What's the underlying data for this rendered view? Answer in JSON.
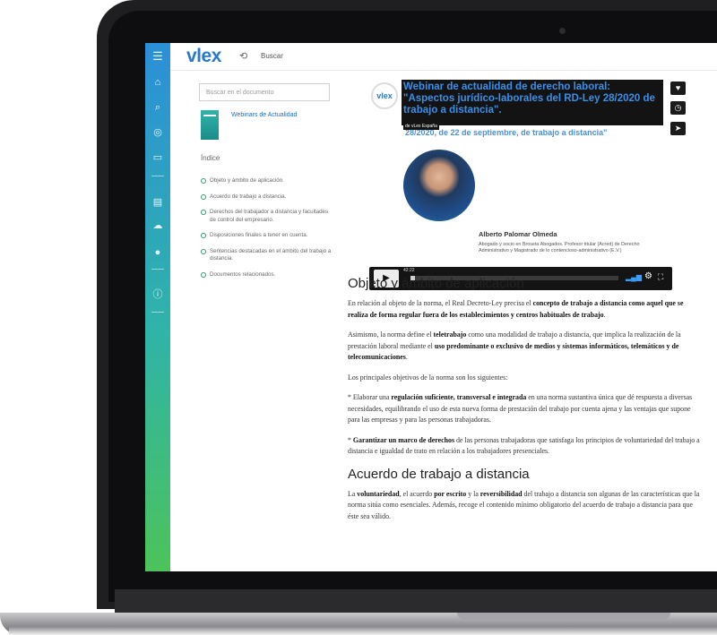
{
  "app": {
    "logo": "vlex",
    "search_label": "Buscar"
  },
  "sidebar": {
    "icons": [
      "menu-icon",
      "home-icon",
      "search-icon",
      "compass-icon",
      "folder-icon",
      "book-icon",
      "cloud-icon",
      "bulb-icon",
      "info-icon"
    ]
  },
  "left_panel": {
    "search_placeholder": "Buscar en el documento",
    "document_title": "Webinars de Actualidad",
    "index_title": "Índice",
    "index_items": [
      "Objeto y ámbito de aplicación.",
      "Acuerdo de trabajo a distancia.",
      "Derechos del trabajador a distancia y facultades de control del empresario.",
      "Disposiciones finales a tener en cuenta.",
      "Sentencias destacadas en el ámbito del trabajo a distancia.",
      "Documentos relacionados."
    ]
  },
  "webinar": {
    "badge": "vlex",
    "title": "Webinar de actualidad de derecho laboral: \"Aspectos jurídico-laborales del RD-Ley 28/2020 de trabajo a distancia\".",
    "subtitle": "de vLex España",
    "overlay_title": "28/2020, de 22 de septiembre, de trabajo a distancia\"",
    "speaker_name": "Alberto Palomar Olmeda",
    "speaker_desc": "Abogado y socio en Broseta Abogados. Profesor titular (Acred) de Derecho Administrativo y Magistrado de lo contencioso-administrativo (E.V.)",
    "player": {
      "time": "42:22",
      "progress": 0.02
    }
  },
  "article": {
    "h1": "Objeto y ámbito de aplicación",
    "p1_a": "En relación al objeto de la norma, el Real Decreto-Ley precisa el ",
    "p1_b": "concepto de trabajo a distancia como aquel que se realiza de forma regular fuera de los establecimientos y centros habituales de trabajo",
    "p1_c": ".",
    "p2_a": "Asimismo, la norma define el ",
    "p2_b": "teletrabajo",
    "p2_c": " como una modalidad de trabajo a distancia, que implica la realización de la prestación laboral mediante el ",
    "p2_d": "uso predominante o exclusivo de medios y sistemas informáticos, telemáticos y de telecomunicaciones",
    "p2_e": ".",
    "p3": "Los principales objetivos de la norma son los siguientes:",
    "p4_a": "* Elaborar una ",
    "p4_b": "regulación suficiente, transversal e integrada",
    "p4_c": " en una norma sustantiva única que dé respuesta a diversas necesidades, equilibrando el uso de esta nueva forma de prestación del trabajo por cuenta ajena y las ventajas que supone para las empresas y para las personas trabajadoras.",
    "p5_a": "* ",
    "p5_b": "Garantizar un marco de derechos",
    "p5_c": " de las personas trabajadoras que satisfaga los principios de voluntariedad del trabajo a distancia e igualdad de trato en relación a los trabajadores presenciales.",
    "h2": "Acuerdo de trabajo a distancia",
    "p6_a": "La ",
    "p6_b": "voluntariedad",
    "p6_c": ", el acuerdo ",
    "p6_d": "por escrito",
    "p6_e": " y la ",
    "p6_f": "reversibilidad",
    "p6_g": " del trabajo a distancia son algunas de las características que la norma sitúa como esenciales. Además, recoge el contenido mínimo obligatorio del acuerdo de trabajo a distancia para que éste sea válido."
  }
}
